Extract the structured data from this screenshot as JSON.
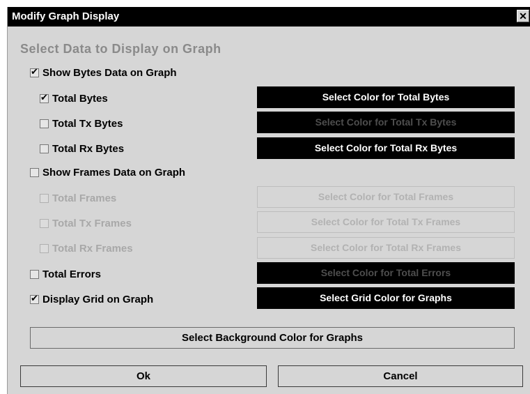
{
  "window": {
    "title": "Modify Graph Display",
    "close_glyph": "✕"
  },
  "heading": "Select Data to Display on Graph",
  "options": {
    "bytes": {
      "label": "Show Bytes Data on Graph",
      "checked": true
    },
    "total_bytes": {
      "label": "Total Bytes",
      "checked": true,
      "button": "Select Color for Total Bytes"
    },
    "total_tx_bytes": {
      "label": "Total Tx Bytes",
      "checked": false,
      "button": "Select Color for Total Tx Bytes"
    },
    "total_rx_bytes": {
      "label": "Total Rx Bytes",
      "checked": false,
      "button": "Select Color for Total Rx Bytes"
    },
    "frames": {
      "label": "Show Frames Data on Graph",
      "checked": false
    },
    "total_frames": {
      "label": "Total Frames",
      "checked": false,
      "button": "Select Color for Total Frames"
    },
    "total_tx_frames": {
      "label": "Total Tx Frames",
      "checked": false,
      "button": "Select Color for Total Tx Frames"
    },
    "total_rx_frames": {
      "label": "Total Rx Frames",
      "checked": false,
      "button": "Select Color for Total Rx Frames"
    },
    "total_errors": {
      "label": "Total Errors",
      "checked": false,
      "button": "Select Color for Total Errors"
    },
    "grid": {
      "label": "Display Grid on Graph",
      "checked": true,
      "button": "Select Grid Color for Graphs"
    }
  },
  "background_button": "Select Background Color for Graphs",
  "footer": {
    "ok": "Ok",
    "cancel": "Cancel"
  },
  "colors": {
    "titlebar": "#000000",
    "dialog_bg": "#d6d6d6",
    "color_button_bg": "#000000",
    "disabled_text": "#a8a8a8"
  }
}
